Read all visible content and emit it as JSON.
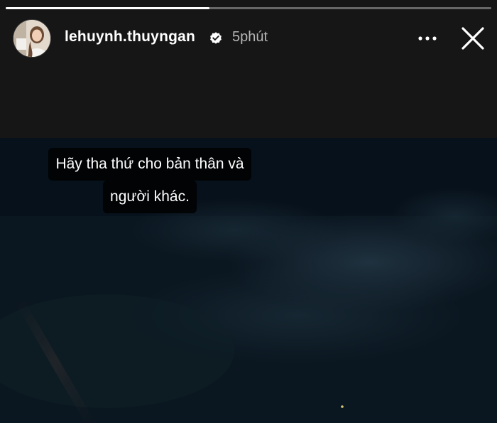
{
  "story": {
    "progress": 0.42,
    "progress_color": "#ffffff",
    "author": {
      "username": "lehuynh.thuyngan",
      "verified": true,
      "verified_icon": "verified-badge-icon"
    },
    "timestamp": "5phút",
    "actions": {
      "more_icon": "more-horizontal-icon",
      "close_icon": "close-icon"
    },
    "caption": {
      "line1": "Hãy tha thứ cho bản thân và",
      "line2": "người khác."
    },
    "background": {
      "type": "night-sky-photo",
      "dominant_color": "#0b1822"
    }
  }
}
